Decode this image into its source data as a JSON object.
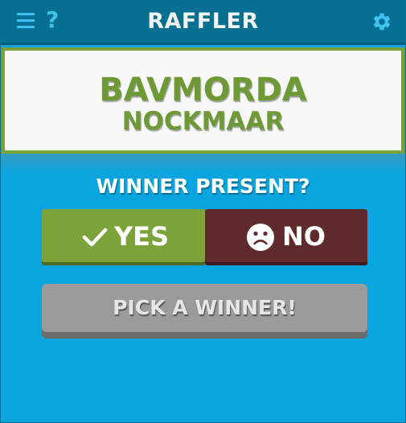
{
  "header": {
    "menu_icon": "hamburger-icon",
    "help_label": "?",
    "title": "RAFFLER",
    "settings_icon": "gear-icon"
  },
  "winner": {
    "first_name": "BAVMORDA",
    "last_name": "NOCKMAAR"
  },
  "prompt": "WINNER PRESENT?",
  "buttons": {
    "yes_label": "YES",
    "yes_icon": "checkmark-icon",
    "no_label": "NO",
    "no_icon": "frown-face-icon",
    "pick_label": "PICK A WINNER!"
  },
  "colors": {
    "background": "#0aa5de",
    "header": "#066f92",
    "accent_green": "#7ca33a",
    "no_red": "#5e2a2c",
    "pick_gray": "#9b9b9b"
  }
}
